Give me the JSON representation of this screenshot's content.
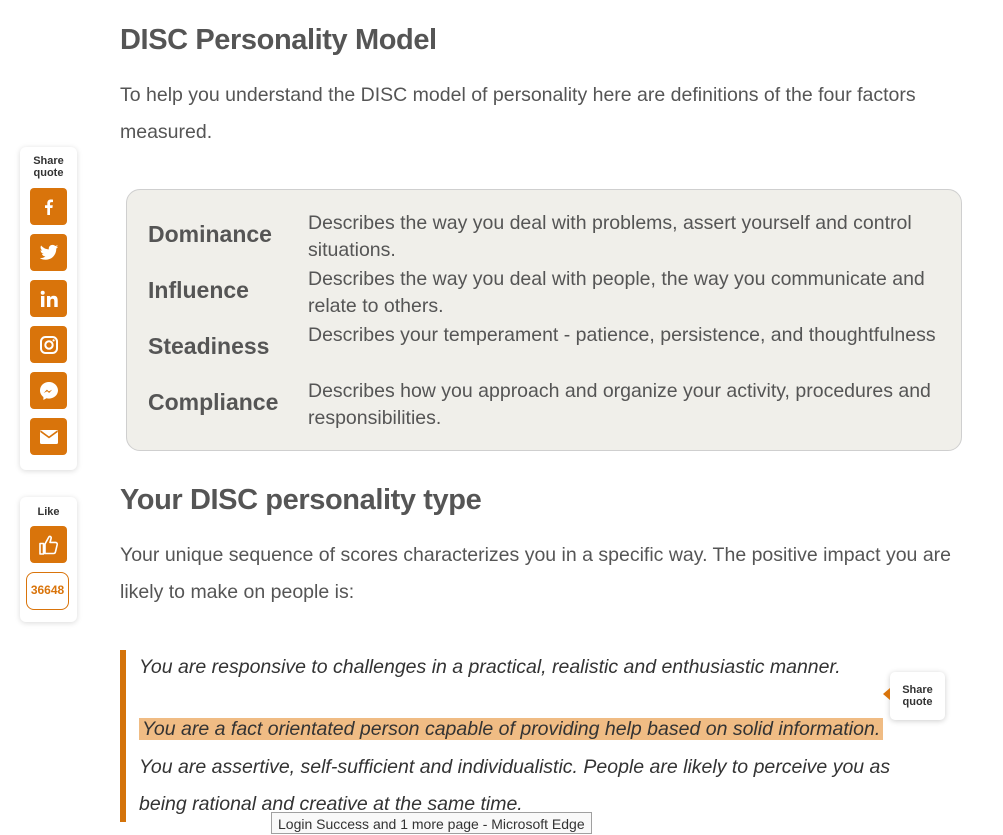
{
  "article": {
    "title": "DISC Personality Model",
    "intro": "To help you understand the DISC model of personality here are definitions of the four factors measured.",
    "factors": [
      {
        "name": "Dominance",
        "description": "Describes the way you deal with problems, assert yourself and control situations."
      },
      {
        "name": "Influence",
        "description": "Describes the way you deal with people, the way you communicate and relate to others."
      },
      {
        "name": "Steadiness",
        "description": "Describes your temperament - patience, persistence, and thoughtfulness"
      },
      {
        "name": "Compliance",
        "description": "Describes how you approach and organize your activity, procedures and responsibilities."
      }
    ],
    "type_heading": "Your DISC personality type",
    "type_intro": "Your unique sequence of scores characterizes you in a specific way. The positive impact you are likely to make on people is:",
    "quotes": [
      "You are responsive to challenges in a practical, realistic and enthusiastic manner.",
      "You are a fact orientated person capable of providing help based on solid information.",
      "You are assertive, self-sufficient and individualistic. People are likely to perceive you as being rational and creative at the same time."
    ]
  },
  "share_panel": {
    "label": "Share quote",
    "buttons": [
      "facebook-icon",
      "twitter-icon",
      "linkedin-icon",
      "instagram-icon",
      "messenger-icon",
      "email-icon"
    ]
  },
  "like_panel": {
    "label": "Like",
    "count": "36648"
  },
  "floating_share": {
    "label": "Share quote"
  },
  "taskbar_tooltip": "Login Success and 1 more page - Microsoft Edge",
  "colors": {
    "accent": "#d9740b",
    "highlight": "#f0bc84",
    "panel_bg": "#f0efea"
  }
}
